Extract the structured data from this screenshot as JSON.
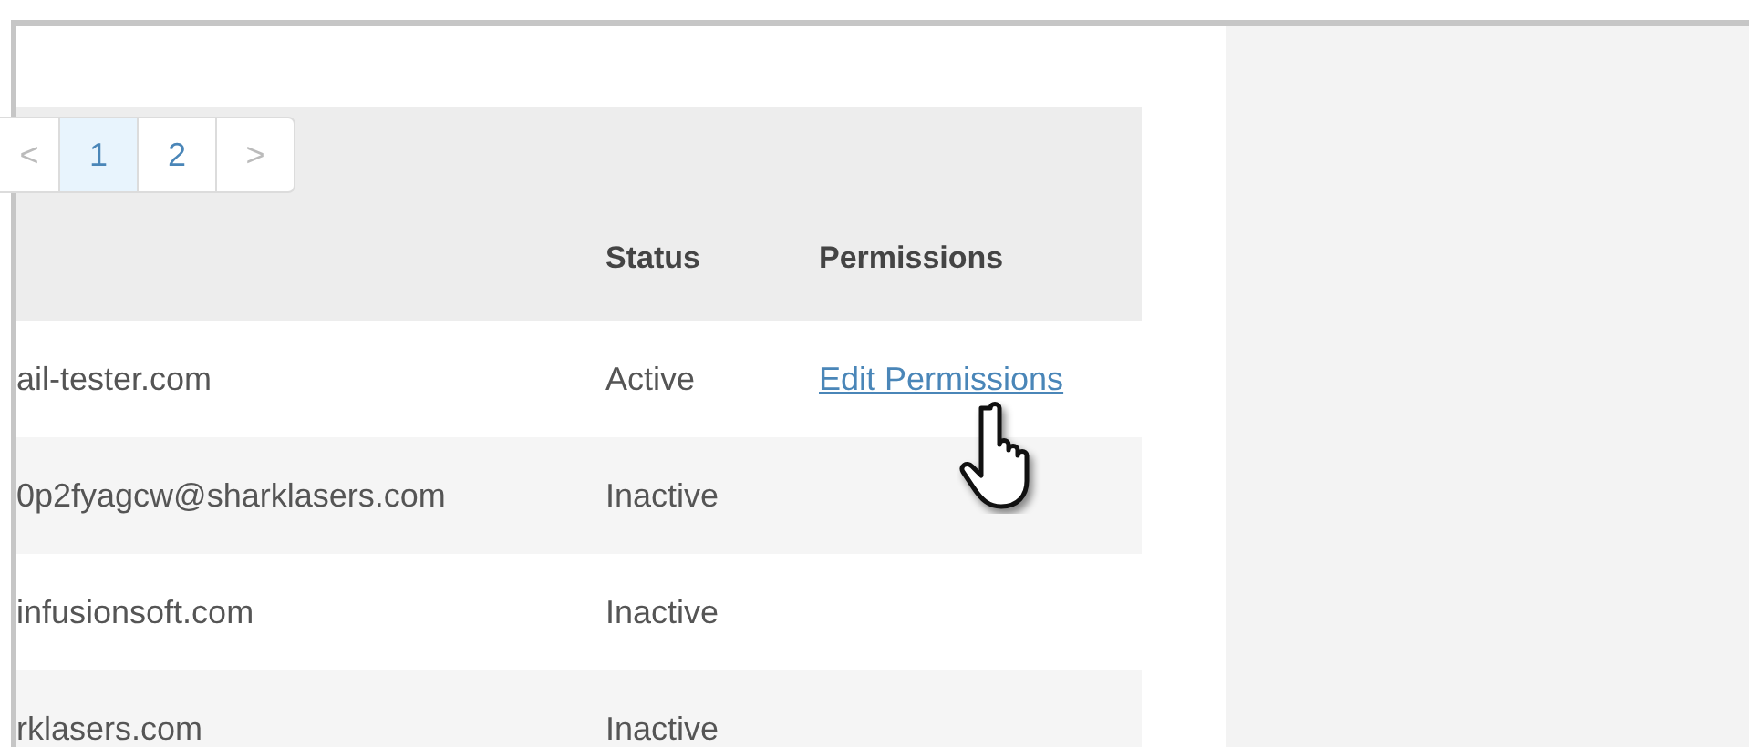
{
  "pagination": [
    {
      "label": "<",
      "kind": "prev",
      "selected": false
    },
    {
      "label": "1",
      "kind": "page",
      "selected": true
    },
    {
      "label": "2",
      "kind": "page",
      "selected": false
    },
    {
      "label": ">",
      "kind": "next",
      "selected": false
    }
  ],
  "table": {
    "columns": [
      "Status",
      "Permissions"
    ],
    "rows": [
      {
        "email": "ail-tester.com",
        "status": "Active",
        "permissions": "Edit Permissions"
      },
      {
        "email": "0p2fyagcw@sharklasers.com",
        "status": "Inactive"
      },
      {
        "email": "infusionsoft.com",
        "status": "Inactive"
      },
      {
        "email": "rklasers.com",
        "status": "Inactive"
      }
    ]
  },
  "cursor": {
    "kind": "hand"
  }
}
